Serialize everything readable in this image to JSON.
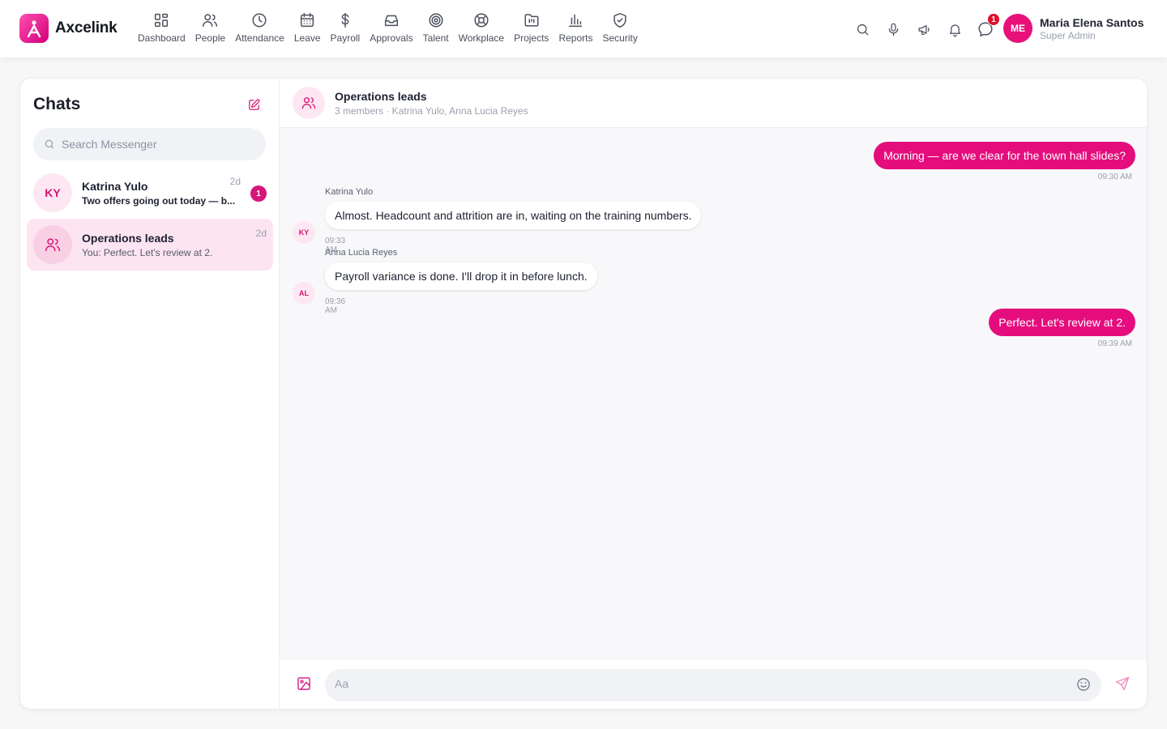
{
  "brand": {
    "name": "Axcelink"
  },
  "nav": [
    {
      "label": "Dashboard",
      "icon": "grid-icon"
    },
    {
      "label": "People",
      "icon": "people-icon"
    },
    {
      "label": "Attendance",
      "icon": "clock-icon"
    },
    {
      "label": "Leave",
      "icon": "calendar-icon"
    },
    {
      "label": "Payroll",
      "icon": "dollar-icon"
    },
    {
      "label": "Approvals",
      "icon": "inbox-icon"
    },
    {
      "label": "Talent",
      "icon": "target-icon"
    },
    {
      "label": "Workplace",
      "icon": "lifebuoy-icon"
    },
    {
      "label": "Projects",
      "icon": "folder-icon"
    },
    {
      "label": "Reports",
      "icon": "bar-chart-icon"
    },
    {
      "label": "Security",
      "icon": "shield-icon"
    }
  ],
  "toolbar": {
    "icons": [
      "search-icon",
      "microphone-icon",
      "megaphone-icon",
      "bell-icon",
      "chat-bubble-icon"
    ],
    "messages_badge": "1"
  },
  "user": {
    "initials": "ME",
    "name": "Maria Elena Santos",
    "role": "Super Admin"
  },
  "sidebar": {
    "title": "Chats",
    "search_placeholder": "Search Messenger",
    "conversations": [
      {
        "initials": "KY",
        "name": "Katrina Yulo",
        "preview": "Two offers going out today — b...",
        "time": "2d",
        "unread": "1"
      },
      {
        "initials": "",
        "name": "Operations leads",
        "preview": "You: Perfect. Let's review at 2.",
        "time": "2d"
      }
    ]
  },
  "chat": {
    "title": "Operations leads",
    "subtitle": "3 members · Katrina Yulo, Anna Lucia Reyes",
    "messages": [
      {
        "from": "me",
        "text": "Morning — are we clear for the town hall slides?",
        "time": "09:30 AM"
      },
      {
        "from": "Katrina Yulo",
        "initials": "KY",
        "text": "Almost. Headcount and attrition are in, waiting on the training numbers.",
        "time": "09:33 AM"
      },
      {
        "from": "Anna Lucia Reyes",
        "initials": "AL",
        "text": "Payroll variance is done. I'll drop it in before lunch.",
        "time": "09:36 AM"
      },
      {
        "from": "me",
        "text": "Perfect. Let's review at 2.",
        "time": "09:39 AM"
      }
    ],
    "composer_placeholder": "Aa"
  },
  "colors": {
    "accent": "#e50d7d",
    "accent_soft": "#fde7f2",
    "badge_red": "#e0102a"
  }
}
